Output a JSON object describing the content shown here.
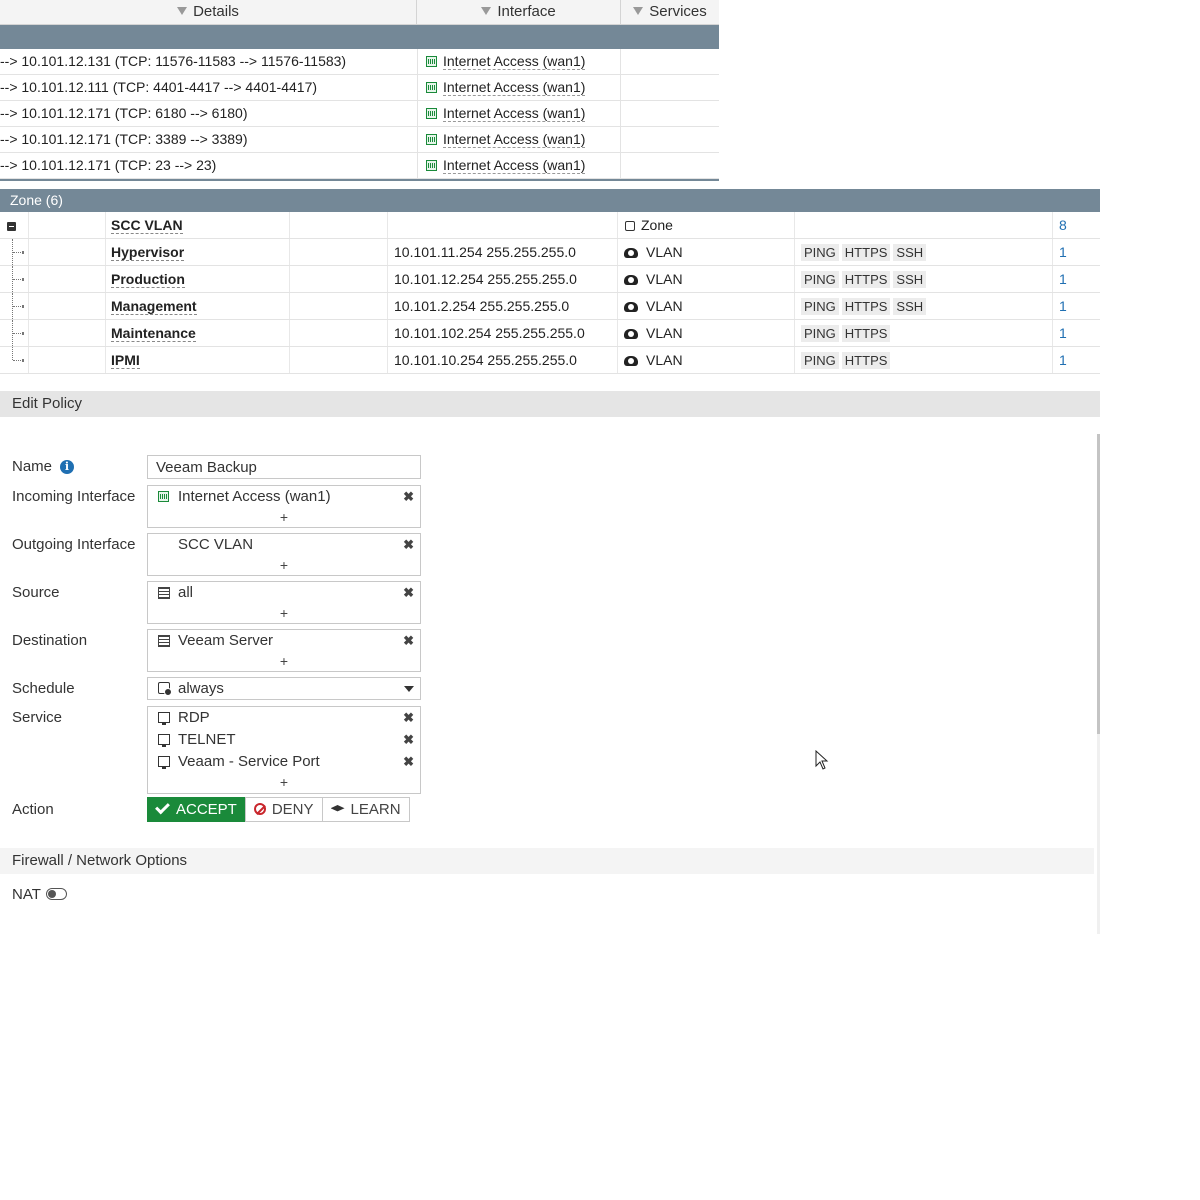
{
  "vip_table": {
    "columns": [
      "Details",
      "Interface",
      "Services"
    ],
    "rows": [
      {
        "details": "--> 10.101.12.131 (TCP: 11576-11583 --> 11576-11583)",
        "interface": "Internet Access (wan1)"
      },
      {
        "details": "--> 10.101.12.111 (TCP: 4401-4417 --> 4401-4417)",
        "interface": "Internet Access (wan1)"
      },
      {
        "details": "--> 10.101.12.171 (TCP: 6180 --> 6180)",
        "interface": "Internet Access (wan1)"
      },
      {
        "details": "--> 10.101.12.171 (TCP: 3389 --> 3389)",
        "interface": "Internet Access (wan1)"
      },
      {
        "details": "--> 10.101.12.171 (TCP: 23 --> 23)",
        "interface": "Internet Access (wan1)"
      }
    ]
  },
  "zone_table": {
    "group_label": "Zone (6)",
    "parent": {
      "name": "SCC VLAN",
      "type": "Zone",
      "ref": "8"
    },
    "children": [
      {
        "name": "Hypervisor",
        "ip": "10.101.11.254 255.255.255.0",
        "type": "VLAN",
        "access": [
          "PING",
          "HTTPS",
          "SSH"
        ],
        "ref": "1"
      },
      {
        "name": "Production",
        "ip": "10.101.12.254 255.255.255.0",
        "type": "VLAN",
        "access": [
          "PING",
          "HTTPS",
          "SSH"
        ],
        "ref": "1"
      },
      {
        "name": "Management",
        "ip": "10.101.2.254 255.255.255.0",
        "type": "VLAN",
        "access": [
          "PING",
          "HTTPS",
          "SSH"
        ],
        "ref": "1"
      },
      {
        "name": "Maintenance",
        "ip": "10.101.102.254 255.255.255.0",
        "type": "VLAN",
        "access": [
          "PING",
          "HTTPS"
        ],
        "ref": "1"
      },
      {
        "name": "IPMI",
        "ip": "10.101.10.254 255.255.255.0",
        "type": "VLAN",
        "access": [
          "PING",
          "HTTPS"
        ],
        "ref": "1"
      }
    ]
  },
  "edit_policy": {
    "title": "Edit Policy",
    "name_label": "Name",
    "name_value": "Veeam Backup",
    "incoming_label": "Incoming Interface",
    "incoming_value": "Internet Access (wan1)",
    "outgoing_label": "Outgoing Interface",
    "outgoing_value": "SCC VLAN",
    "source_label": "Source",
    "source_value": "all",
    "destination_label": "Destination",
    "destination_value": "Veeam Server",
    "schedule_label": "Schedule",
    "schedule_value": "always",
    "service_label": "Service",
    "services": [
      "RDP",
      "TELNET",
      "Veaam - Service Port"
    ],
    "add_symbol": "+",
    "remove_symbol": "✖",
    "action_label": "Action",
    "actions": {
      "accept": "ACCEPT",
      "deny": "DENY",
      "learn": "LEARN"
    },
    "selected_action": "ACCEPT"
  },
  "firewall_options": {
    "title": "Firewall / Network Options",
    "nat_label": "NAT",
    "nat_enabled": false
  },
  "colors": {
    "group_header": "#748897",
    "accept_green": "#1a8a3a",
    "deny_red": "#c9262c",
    "link_blue": "#1f6fb2"
  }
}
